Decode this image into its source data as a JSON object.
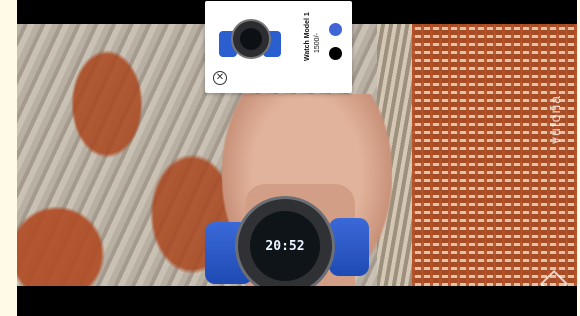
{
  "product": {
    "name": "Watch Model 1",
    "price": "1500/-",
    "colors": [
      "#3f65d6",
      "#000000"
    ]
  },
  "watch_display": {
    "time": "20:52"
  },
  "watermark": {
    "text": "vuforia"
  },
  "icons": {
    "close": "close-circle-icon"
  }
}
